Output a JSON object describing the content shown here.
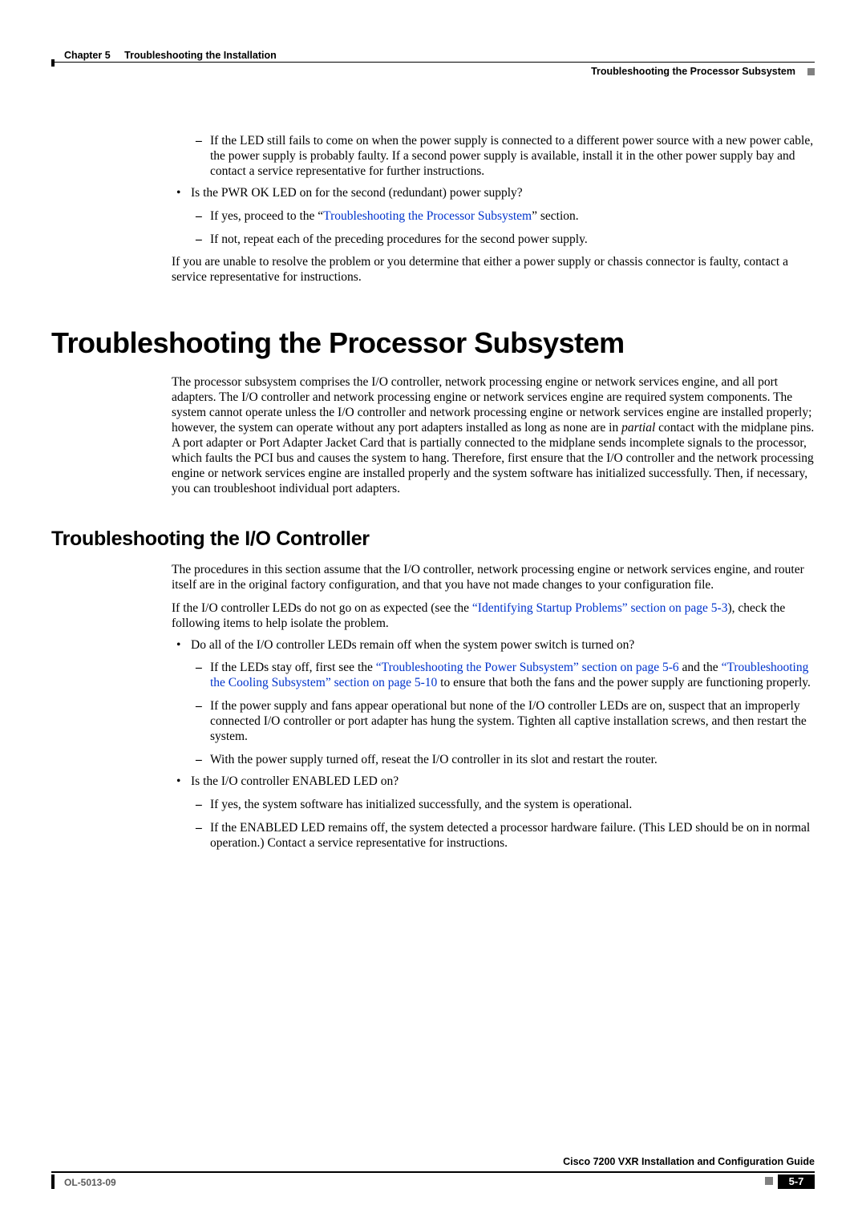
{
  "header": {
    "chapter": "Chapter 5",
    "title": "Troubleshooting the Installation",
    "section": "Troubleshooting the Processor Subsystem"
  },
  "top": {
    "dash1": "If the LED still fails to come on when the power supply is connected to a different power source with a new power cable, the power supply is probably faulty. If a second power supply is available, install it in the other power supply bay and contact a service representative for further instructions.",
    "bullet": "Is the PWR OK LED on for the second (redundant) power supply?",
    "dash2a": "If yes, proceed to the “",
    "dash2a_link": "Troubleshooting the Processor Subsystem",
    "dash2a_tail": "” section.",
    "dash2b": "If not, repeat each of the preceding procedures for the second power supply.",
    "para": "If you are unable to resolve the problem or you determine that either a power supply or chassis connector is faulty, contact a service representative for instructions."
  },
  "h1": "Troubleshooting the Processor Subsystem",
  "s1": {
    "p1a": "The processor subsystem comprises the I/O controller, network processing engine or network services engine, and all port adapters. The I/O controller and network processing engine or network services engine are required system components. The system cannot operate unless the I/O controller and network processing engine or network services engine are installed properly; however, the system can operate without any port adapters installed as long as none are in ",
    "p1_italic": "partial",
    "p1b": " contact with the midplane pins. A port adapter or Port Adapter Jacket Card that is partially connected to the midplane sends incomplete signals to the processor, which faults the PCI bus and causes the system to hang. Therefore, first ensure that the I/O controller and the network processing engine or network services engine are installed properly and the system software has initialized successfully. Then, if necessary, you can troubleshoot individual port adapters."
  },
  "h2": "Troubleshooting the I/O Controller",
  "s2": {
    "p1": "The procedures in this section assume that the I/O controller, network processing engine or network services engine, and router itself are in the original factory configuration, and that you have not made changes to your configuration file.",
    "p2a": "If the I/O controller LEDs do not go on as expected (see the ",
    "p2_link": "“Identifying Startup Problems” section on page 5-3",
    "p2b": "), check the following items to help isolate the problem.",
    "b1": " Do all of the I/O controller LEDs remain off when the system power switch is turned on?",
    "b1_d1a": "If the LEDs stay off, first see the ",
    "b1_d1_link1": "“Troubleshooting the Power Subsystem” section on page 5-6",
    "b1_d1_mid": " and the ",
    "b1_d1_link2": "“Troubleshooting the Cooling Subsystem” section on page 5-10",
    "b1_d1b": " to ensure that both the fans and the power supply are functioning properly.",
    "b1_d2": "If the power supply and fans appear operational but none of the I/O controller LEDs are on, suspect that an improperly connected I/O controller or port adapter has hung the system. Tighten all captive installation screws, and then restart the system.",
    "b1_d3": "With the power supply turned off, reseat the I/O controller in its slot and restart the router.",
    "b2": "Is the I/O controller ENABLED LED on?",
    "b2_d1": "If yes, the system software has initialized successfully, and the system is operational.",
    "b2_d2": "If the ENABLED LED remains off, the system detected a processor hardware failure. (This LED should be on in normal operation.) Contact a service representative for instructions."
  },
  "footer": {
    "guide": "Cisco 7200 VXR Installation and Configuration Guide",
    "ol": "OL-5013-09",
    "page": "5-7"
  }
}
